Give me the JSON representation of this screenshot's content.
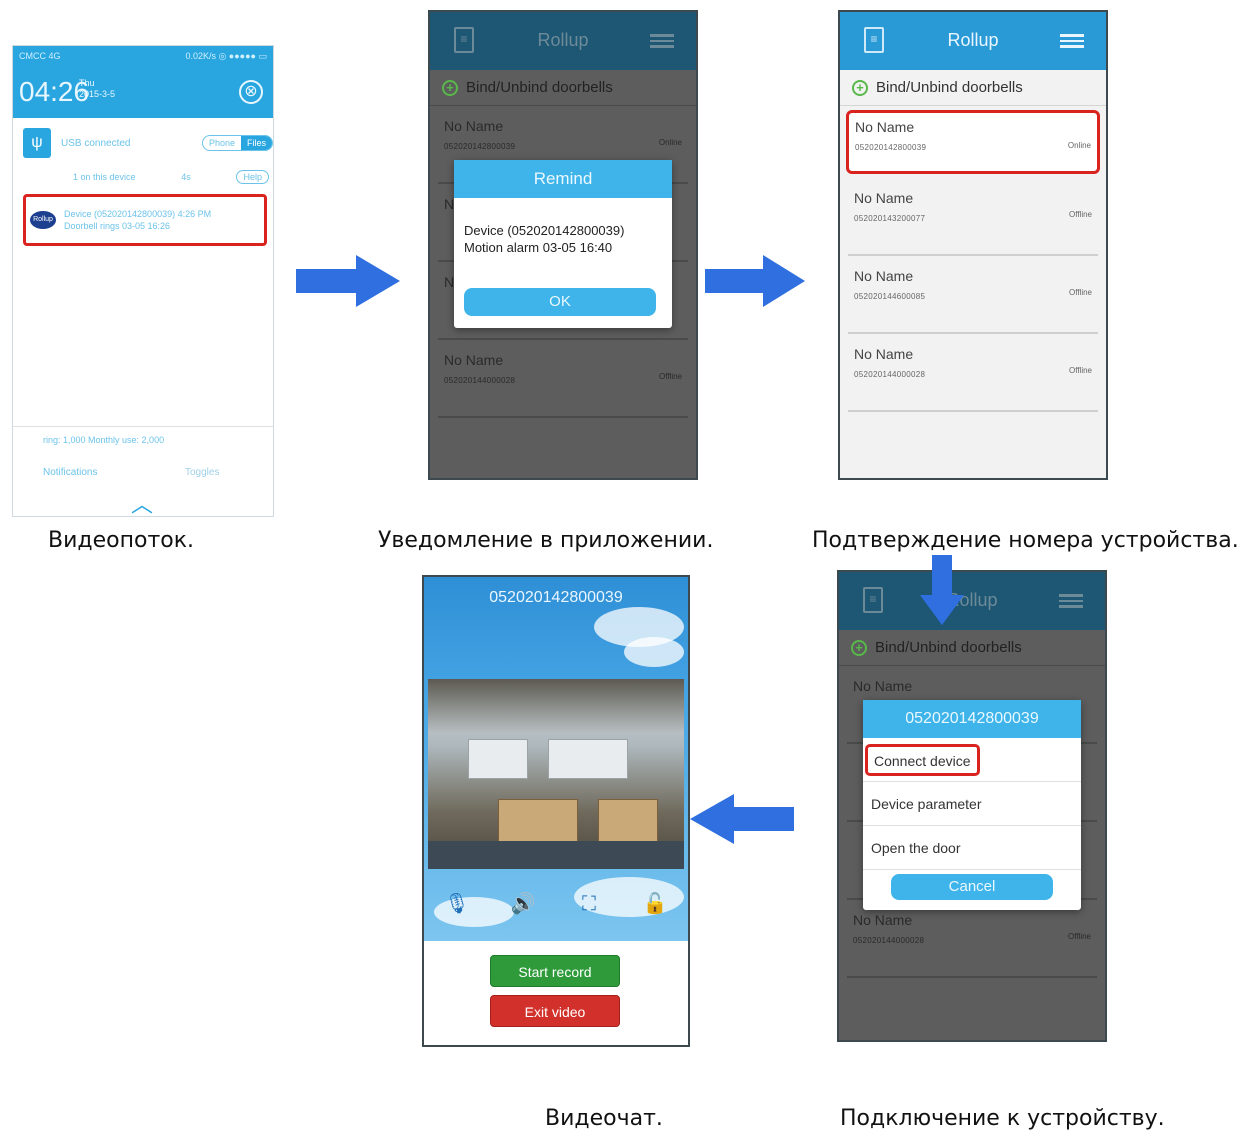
{
  "screen1": {
    "status_left": "CMCC 4G",
    "status_right": "0.02K/s ◎ ●●●●● ▭",
    "time": "04:26",
    "day_line1": "Thu",
    "day_line2": "2015-3-5",
    "usb_text": "USB connected",
    "seg_phone": "Phone",
    "seg_files": "Files",
    "device_row": "1 on this device",
    "device_row_short": "4s",
    "help": "Help",
    "app_icon": "Rollup",
    "notif_line1": "Device (052020142800039)  4:26 PM",
    "notif_line2": "Doorbell rings 03-05 16:26",
    "bottom_line": "ring: 1,000  Monthly use: 2,000",
    "tab_notifications": "Notifications",
    "tab_toggles": "Toggles"
  },
  "screen2": {
    "title": "Rollup",
    "bind": "Bind/Unbind doorbells",
    "items": [
      {
        "name": "No Name",
        "id": "052020142800039",
        "status": "Online"
      },
      {
        "name": "No Name",
        "id": "",
        "status": ""
      },
      {
        "name": "No Name",
        "id": "",
        "status": ""
      },
      {
        "name": "No Name",
        "id": "052020144000028",
        "status": "Offline"
      }
    ],
    "dialog_title": "Remind",
    "dialog_line1": "Device  (052020142800039)",
    "dialog_line2": "Motion alarm 03-05 16:40",
    "dialog_ok": "OK"
  },
  "screen3": {
    "title": "Rollup",
    "bind": "Bind/Unbind doorbells",
    "items": [
      {
        "name": "No Name",
        "id": "052020142800039",
        "status": "Online"
      },
      {
        "name": "No Name",
        "id": "052020143200077",
        "status": "Offline"
      },
      {
        "name": "No Name",
        "id": "052020144600085",
        "status": "Offline"
      },
      {
        "name": "No Name",
        "id": "052020144000028",
        "status": "Offline"
      }
    ]
  },
  "screen4": {
    "title": "052020142800039",
    "start_record": "Start record",
    "exit_video": "Exit video"
  },
  "screen5": {
    "title": "Rollup",
    "bind": "Bind/Unbind doorbells",
    "items": [
      {
        "name": "No Name",
        "id": "",
        "status": ""
      },
      {
        "name": "",
        "id": "",
        "status": ""
      },
      {
        "name": "",
        "id": "",
        "status": ""
      },
      {
        "name": "No Name",
        "id": "052020144000028",
        "status": "Offline"
      }
    ],
    "menu_title": "052020142800039",
    "menu_connect": "Connect device",
    "menu_params": "Device parameter",
    "menu_door": "Open the door",
    "menu_cancel": "Cancel"
  },
  "captions": {
    "c1": "Видеопоток.",
    "c2": "Уведомление в приложении.",
    "c3": "Подтверждение номера устройства.",
    "c4": "Видеочат.",
    "c5": "Подключение к устройству."
  },
  "colors": {
    "app_blue": "#2a9ad6",
    "highlight_red": "#d9231f",
    "arrow_blue": "#2f6fe0",
    "start_green": "#2e9a3a",
    "exit_red": "#d2302b"
  }
}
